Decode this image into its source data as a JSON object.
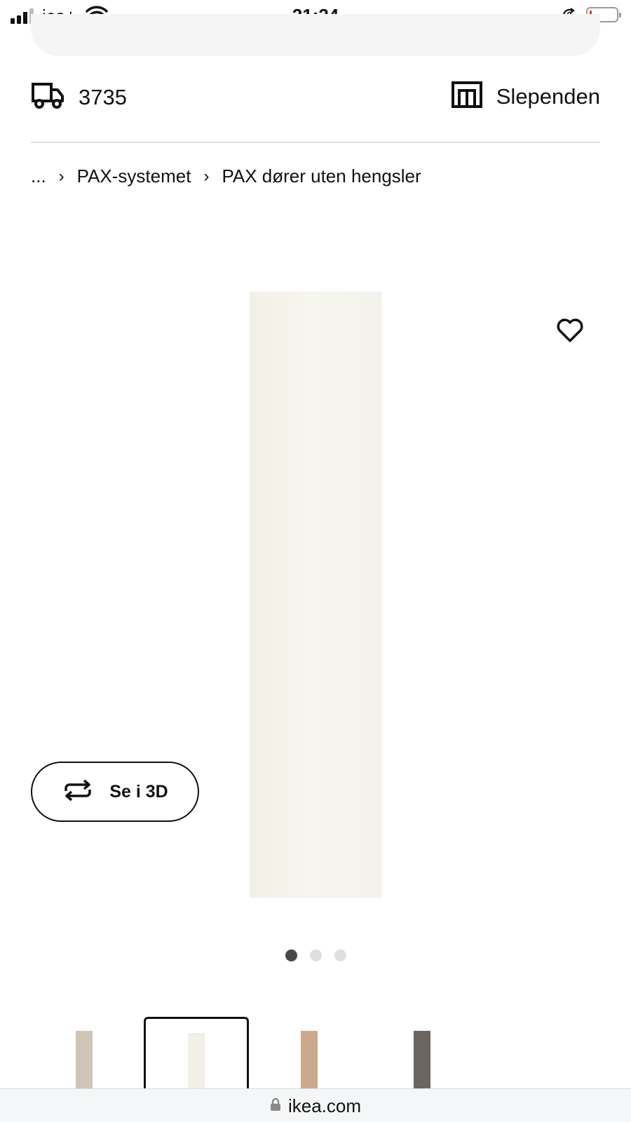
{
  "status_bar": {
    "carrier": "ice+",
    "time": "21:24",
    "battery_level": 0.05
  },
  "delivery": {
    "postal_code": "3735",
    "icon": "truck-icon"
  },
  "store": {
    "name": "Slependen",
    "icon": "store-icon"
  },
  "breadcrumb": {
    "ellipsis": "...",
    "items": [
      "PAX-systemet",
      "PAX dører uten hengsler"
    ]
  },
  "gallery": {
    "favorite_icon": "heart-icon",
    "view_3d_label": "Se i 3D",
    "view_3d_icon": "rotate-icon",
    "total_images": 3,
    "current_image": 1
  },
  "variants": [
    {
      "color": "#cfc4b6",
      "selected": false
    },
    {
      "color": "#f1efe8",
      "selected": true
    },
    {
      "color": "#cba98c",
      "selected": false
    },
    {
      "color": "#6b6561",
      "selected": false
    }
  ],
  "browser": {
    "url": "ikea.com",
    "icon": "lock-icon"
  }
}
